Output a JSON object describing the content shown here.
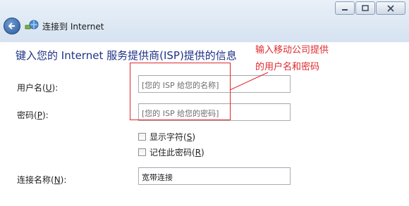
{
  "window": {
    "title": "连接到 Internet",
    "controls": [
      "minimize",
      "maximize",
      "close"
    ]
  },
  "heading": "键入您的 Internet 服务提供商(ISP)提供的信息",
  "fields": {
    "username": {
      "label": "用户名(",
      "accel": "U",
      "label_end": "):",
      "placeholder": "[您的 ISP 给您的名称]",
      "value": ""
    },
    "password": {
      "label": "密码(",
      "accel": "P",
      "label_end": "):",
      "placeholder": "[您的 ISP 给您的密码]",
      "value": ""
    },
    "connection_name": {
      "label": "连接名称(",
      "accel": "N",
      "label_end": "):",
      "value": "宽带连接"
    }
  },
  "checkboxes": {
    "show_chars": {
      "label": "显示字符(",
      "accel": "S",
      "label_end": ")",
      "checked": false
    },
    "remember": {
      "label": "记住此密码(",
      "accel": "R",
      "label_end": ")",
      "checked": false
    }
  },
  "annotation": {
    "line1": "输入移动公司提供",
    "line2": "的用户名和密码",
    "color": "#e0282c"
  },
  "colors": {
    "heading": "#1e3287",
    "titlebar": "#dde8f4"
  }
}
